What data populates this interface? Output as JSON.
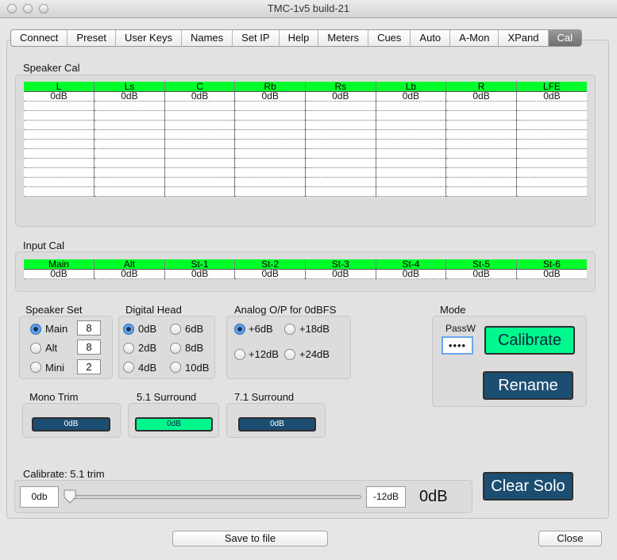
{
  "window": {
    "title": "TMC-1v5 build-21"
  },
  "tabs": [
    {
      "label": "Connect"
    },
    {
      "label": "Preset"
    },
    {
      "label": "User Keys"
    },
    {
      "label": "Names"
    },
    {
      "label": "Set IP"
    },
    {
      "label": "Help"
    },
    {
      "label": "Meters"
    },
    {
      "label": "Cues"
    },
    {
      "label": "Auto"
    },
    {
      "label": "A-Mon"
    },
    {
      "label": "XPand"
    },
    {
      "label": "Cal",
      "active": true
    }
  ],
  "speaker_cal": {
    "title": "Speaker Cal",
    "headers": [
      "L",
      "Ls",
      "C",
      "Rb",
      "Rs",
      "Lb",
      "R",
      "LFE"
    ],
    "values": [
      "0dB",
      "0dB",
      "0dB",
      "0dB",
      "0dB",
      "0dB",
      "0dB",
      "0dB"
    ]
  },
  "input_cal": {
    "title": "Input Cal",
    "headers": [
      "Main",
      "Alt",
      "St-1",
      "St-2",
      "St-3",
      "St-4",
      "St-5",
      "St-6"
    ],
    "values": [
      "0dB",
      "0dB",
      "0dB",
      "0dB",
      "0dB",
      "0dB",
      "0dB",
      "0dB"
    ]
  },
  "speaker_set": {
    "title": "Speaker Set",
    "options": [
      {
        "label": "Main",
        "value": "8",
        "selected": true
      },
      {
        "label": "Alt",
        "value": "8",
        "selected": false
      },
      {
        "label": "Mini",
        "value": "2",
        "selected": false
      }
    ]
  },
  "digital_head": {
    "title": "Digital Head",
    "options": [
      {
        "label": "0dB",
        "selected": true
      },
      {
        "label": "6dB",
        "selected": false
      },
      {
        "label": "2dB",
        "selected": false
      },
      {
        "label": "8dB",
        "selected": false
      },
      {
        "label": "4dB",
        "selected": false
      },
      {
        "label": "10dB",
        "selected": false
      }
    ]
  },
  "analog_op": {
    "title": "Analog O/P for 0dBFS",
    "options": [
      {
        "label": "+6dB",
        "selected": true
      },
      {
        "label": "+18dB",
        "selected": false
      },
      {
        "label": "+12dB",
        "selected": false
      },
      {
        "label": "+24dB",
        "selected": false
      }
    ]
  },
  "mode": {
    "title": "Mode",
    "password_label": "PassW",
    "password_value": "••••",
    "calibrate_label": "Calibrate",
    "rename_label": "Rename"
  },
  "trims": {
    "mono": {
      "title": "Mono Trim",
      "value": "0dB"
    },
    "s51": {
      "title": "5.1 Surround",
      "value": "0dB"
    },
    "s71": {
      "title": "7.1 Surround",
      "value": "0dB"
    }
  },
  "calibrate": {
    "label": "Calibrate: 5.1 trim",
    "min_value": "0db",
    "max_value": "-12dB",
    "readout": "0dB",
    "slider_position": 0
  },
  "clear_solo_label": "Clear Solo",
  "footer": {
    "save_label": "Save to file",
    "close_label": "Close"
  },
  "colors": {
    "active_green": "#00ff2a",
    "button_green": "#00f88f",
    "button_navy": "#1c4e72"
  }
}
